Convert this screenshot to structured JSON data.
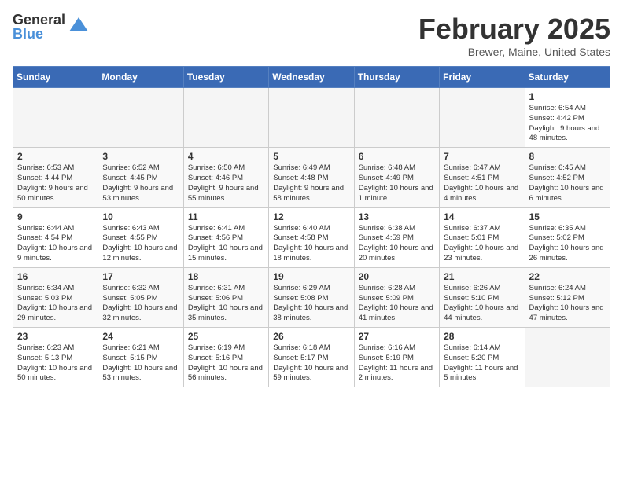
{
  "header": {
    "logo": {
      "general": "General",
      "blue": "Blue"
    },
    "title": "February 2025",
    "location": "Brewer, Maine, United States"
  },
  "weekdays": [
    "Sunday",
    "Monday",
    "Tuesday",
    "Wednesday",
    "Thursday",
    "Friday",
    "Saturday"
  ],
  "weeks": [
    [
      {
        "day": "",
        "info": ""
      },
      {
        "day": "",
        "info": ""
      },
      {
        "day": "",
        "info": ""
      },
      {
        "day": "",
        "info": ""
      },
      {
        "day": "",
        "info": ""
      },
      {
        "day": "",
        "info": ""
      },
      {
        "day": "1",
        "info": "Sunrise: 6:54 AM\nSunset: 4:42 PM\nDaylight: 9 hours and 48 minutes."
      }
    ],
    [
      {
        "day": "2",
        "info": "Sunrise: 6:53 AM\nSunset: 4:44 PM\nDaylight: 9 hours and 50 minutes."
      },
      {
        "day": "3",
        "info": "Sunrise: 6:52 AM\nSunset: 4:45 PM\nDaylight: 9 hours and 53 minutes."
      },
      {
        "day": "4",
        "info": "Sunrise: 6:50 AM\nSunset: 4:46 PM\nDaylight: 9 hours and 55 minutes."
      },
      {
        "day": "5",
        "info": "Sunrise: 6:49 AM\nSunset: 4:48 PM\nDaylight: 9 hours and 58 minutes."
      },
      {
        "day": "6",
        "info": "Sunrise: 6:48 AM\nSunset: 4:49 PM\nDaylight: 10 hours and 1 minute."
      },
      {
        "day": "7",
        "info": "Sunrise: 6:47 AM\nSunset: 4:51 PM\nDaylight: 10 hours and 4 minutes."
      },
      {
        "day": "8",
        "info": "Sunrise: 6:45 AM\nSunset: 4:52 PM\nDaylight: 10 hours and 6 minutes."
      }
    ],
    [
      {
        "day": "9",
        "info": "Sunrise: 6:44 AM\nSunset: 4:54 PM\nDaylight: 10 hours and 9 minutes."
      },
      {
        "day": "10",
        "info": "Sunrise: 6:43 AM\nSunset: 4:55 PM\nDaylight: 10 hours and 12 minutes."
      },
      {
        "day": "11",
        "info": "Sunrise: 6:41 AM\nSunset: 4:56 PM\nDaylight: 10 hours and 15 minutes."
      },
      {
        "day": "12",
        "info": "Sunrise: 6:40 AM\nSunset: 4:58 PM\nDaylight: 10 hours and 18 minutes."
      },
      {
        "day": "13",
        "info": "Sunrise: 6:38 AM\nSunset: 4:59 PM\nDaylight: 10 hours and 20 minutes."
      },
      {
        "day": "14",
        "info": "Sunrise: 6:37 AM\nSunset: 5:01 PM\nDaylight: 10 hours and 23 minutes."
      },
      {
        "day": "15",
        "info": "Sunrise: 6:35 AM\nSunset: 5:02 PM\nDaylight: 10 hours and 26 minutes."
      }
    ],
    [
      {
        "day": "16",
        "info": "Sunrise: 6:34 AM\nSunset: 5:03 PM\nDaylight: 10 hours and 29 minutes."
      },
      {
        "day": "17",
        "info": "Sunrise: 6:32 AM\nSunset: 5:05 PM\nDaylight: 10 hours and 32 minutes."
      },
      {
        "day": "18",
        "info": "Sunrise: 6:31 AM\nSunset: 5:06 PM\nDaylight: 10 hours and 35 minutes."
      },
      {
        "day": "19",
        "info": "Sunrise: 6:29 AM\nSunset: 5:08 PM\nDaylight: 10 hours and 38 minutes."
      },
      {
        "day": "20",
        "info": "Sunrise: 6:28 AM\nSunset: 5:09 PM\nDaylight: 10 hours and 41 minutes."
      },
      {
        "day": "21",
        "info": "Sunrise: 6:26 AM\nSunset: 5:10 PM\nDaylight: 10 hours and 44 minutes."
      },
      {
        "day": "22",
        "info": "Sunrise: 6:24 AM\nSunset: 5:12 PM\nDaylight: 10 hours and 47 minutes."
      }
    ],
    [
      {
        "day": "23",
        "info": "Sunrise: 6:23 AM\nSunset: 5:13 PM\nDaylight: 10 hours and 50 minutes."
      },
      {
        "day": "24",
        "info": "Sunrise: 6:21 AM\nSunset: 5:15 PM\nDaylight: 10 hours and 53 minutes."
      },
      {
        "day": "25",
        "info": "Sunrise: 6:19 AM\nSunset: 5:16 PM\nDaylight: 10 hours and 56 minutes."
      },
      {
        "day": "26",
        "info": "Sunrise: 6:18 AM\nSunset: 5:17 PM\nDaylight: 10 hours and 59 minutes."
      },
      {
        "day": "27",
        "info": "Sunrise: 6:16 AM\nSunset: 5:19 PM\nDaylight: 11 hours and 2 minutes."
      },
      {
        "day": "28",
        "info": "Sunrise: 6:14 AM\nSunset: 5:20 PM\nDaylight: 11 hours and 5 minutes."
      },
      {
        "day": "",
        "info": ""
      }
    ]
  ]
}
